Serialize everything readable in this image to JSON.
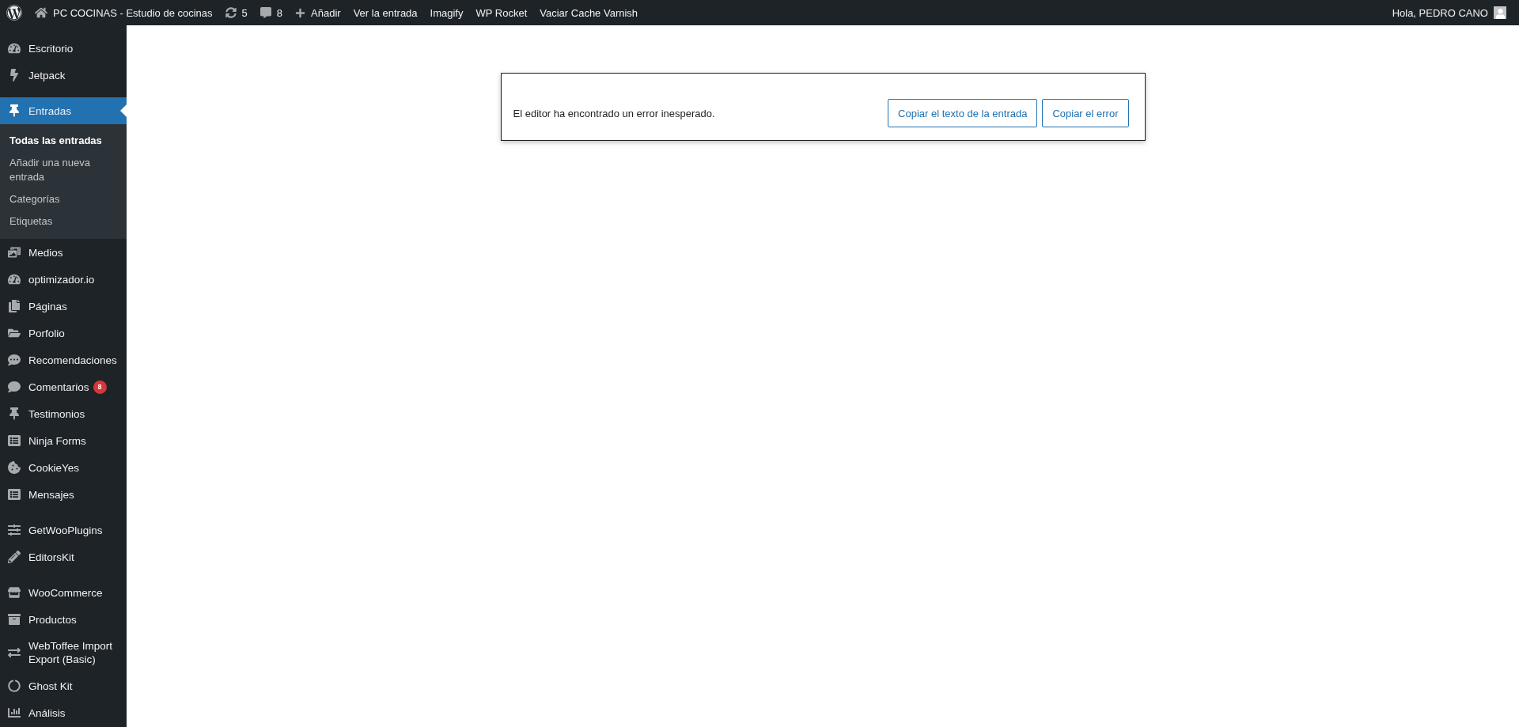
{
  "admin_bar": {
    "site_name": "PC COCINAS - Estudio de cocinas",
    "updates": "5",
    "comments": "8",
    "new": "Añadir",
    "links": [
      "Ver la entrada",
      "Imagify",
      "WP Rocket",
      "Vaciar Cache Varnish"
    ],
    "greeting": "Hola, PEDRO CANO"
  },
  "sidebar": {
    "items": [
      {
        "kind": "menu",
        "label": "Escritorio",
        "selected": false
      },
      {
        "kind": "menu",
        "label": "Jetpack",
        "selected": false
      },
      {
        "kind": "separator"
      },
      {
        "kind": "menu",
        "label": "Entradas",
        "selected": true,
        "children": [
          {
            "label": "Todas las entradas",
            "selected": true
          },
          {
            "label": "Añadir una nueva entrada",
            "selected": false
          },
          {
            "label": "Categorías",
            "selected": false
          },
          {
            "label": "Etiquetas",
            "selected": false
          }
        ]
      },
      {
        "kind": "menu",
        "label": "Medios",
        "selected": false
      },
      {
        "kind": "menu",
        "label": "optimizador.io",
        "selected": false
      },
      {
        "kind": "menu",
        "label": "Páginas",
        "selected": false
      },
      {
        "kind": "menu",
        "label": "Porfolio",
        "selected": false
      },
      {
        "kind": "menu",
        "label": "Recomendaciones",
        "selected": false
      },
      {
        "kind": "menu",
        "label": "Comentarios",
        "selected": false,
        "badge": "8"
      },
      {
        "kind": "menu",
        "label": "Testimonios",
        "selected": false
      },
      {
        "kind": "menu",
        "label": "Ninja Forms",
        "selected": false
      },
      {
        "kind": "menu",
        "label": "CookieYes",
        "selected": false
      },
      {
        "kind": "menu",
        "label": "Mensajes",
        "selected": false
      },
      {
        "kind": "separator"
      },
      {
        "kind": "menu",
        "label": "GetWooPlugins",
        "selected": false
      },
      {
        "kind": "menu",
        "label": "EditorsKit",
        "selected": false
      },
      {
        "kind": "separator"
      },
      {
        "kind": "menu",
        "label": "WooCommerce",
        "selected": false
      },
      {
        "kind": "menu",
        "label": "Productos",
        "selected": false
      },
      {
        "kind": "menu",
        "label": "WebToffee Import Export (Basic)",
        "selected": false
      },
      {
        "kind": "menu",
        "label": "Ghost Kit",
        "selected": false
      },
      {
        "kind": "menu",
        "label": "Análisis",
        "selected": false
      }
    ]
  },
  "notice": {
    "message": "El editor ha encontrado un error inesperado.",
    "buttons": [
      "Copiar el texto de la entrada",
      "Copiar el error"
    ]
  }
}
